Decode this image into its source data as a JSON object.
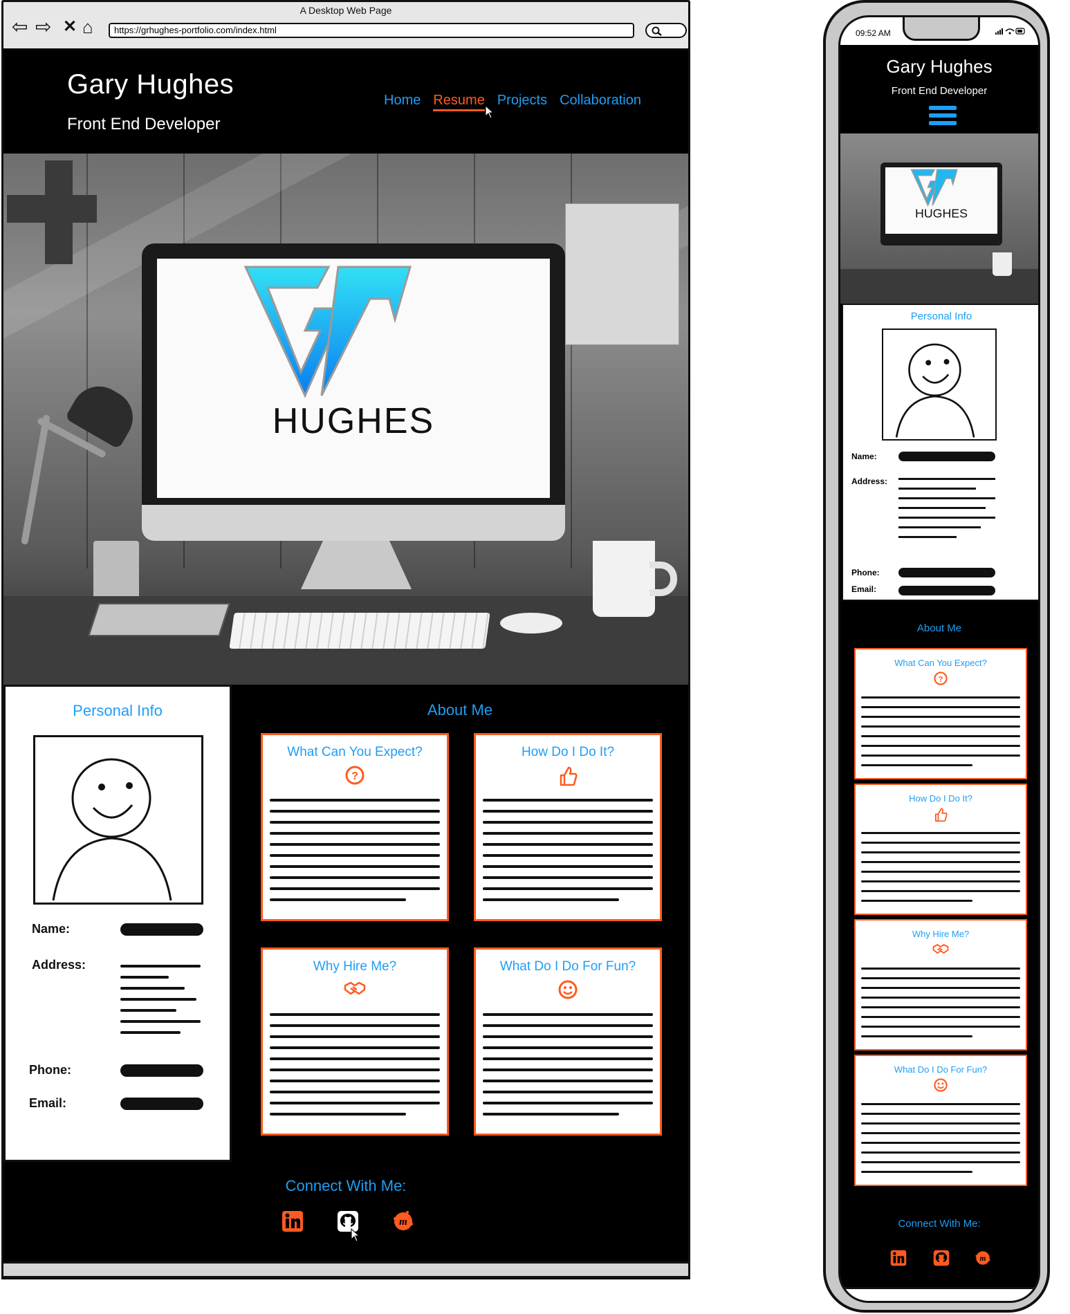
{
  "window_title": "A Desktop Web Page",
  "url": "https://grhughes-portfolio.com/index.html",
  "site": {
    "name": "Gary Hughes",
    "role": "Front End Developer",
    "logo_text": "HUGHES"
  },
  "nav": {
    "items": [
      "Home",
      "Resume",
      "Projects",
      "Collaboration"
    ],
    "active": "Resume"
  },
  "personal_info": {
    "title": "Personal Info",
    "labels": {
      "name": "Name:",
      "address": "Address:",
      "phone": "Phone:",
      "email": "Email:"
    }
  },
  "about": {
    "title": "About Me",
    "cards": [
      {
        "title": "What Can You Expect?",
        "icon": "question-circle-icon"
      },
      {
        "title": "How Do I Do It?",
        "icon": "thumbs-up-icon"
      },
      {
        "title": "Why Hire Me?",
        "icon": "handshake-icon"
      },
      {
        "title": "What Do I Do For Fun?",
        "icon": "smile-icon"
      }
    ]
  },
  "connect": {
    "title": "Connect With Me:",
    "links": [
      "linkedin-icon",
      "github-icon",
      "meetup-icon"
    ]
  },
  "phone": {
    "time": "09:52 AM",
    "menu_icon": "hamburger-icon"
  },
  "colors": {
    "accent_blue": "#1e9ef5",
    "accent_orange": "#ff5a1f",
    "background": "#000000"
  }
}
